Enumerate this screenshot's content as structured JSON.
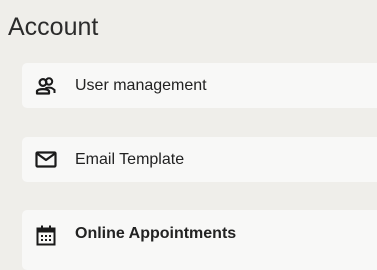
{
  "section": {
    "title": "Account"
  },
  "menu": {
    "items": [
      {
        "label": "User management",
        "icon": "users-icon",
        "active": false
      },
      {
        "label": "Email Template",
        "icon": "envelope-icon",
        "active": false
      },
      {
        "label": "Online Appointments",
        "icon": "calendar-icon",
        "active": true
      }
    ]
  },
  "colors": {
    "background": "#efeeea",
    "card": "#f8f8f7",
    "text": "#222222"
  }
}
